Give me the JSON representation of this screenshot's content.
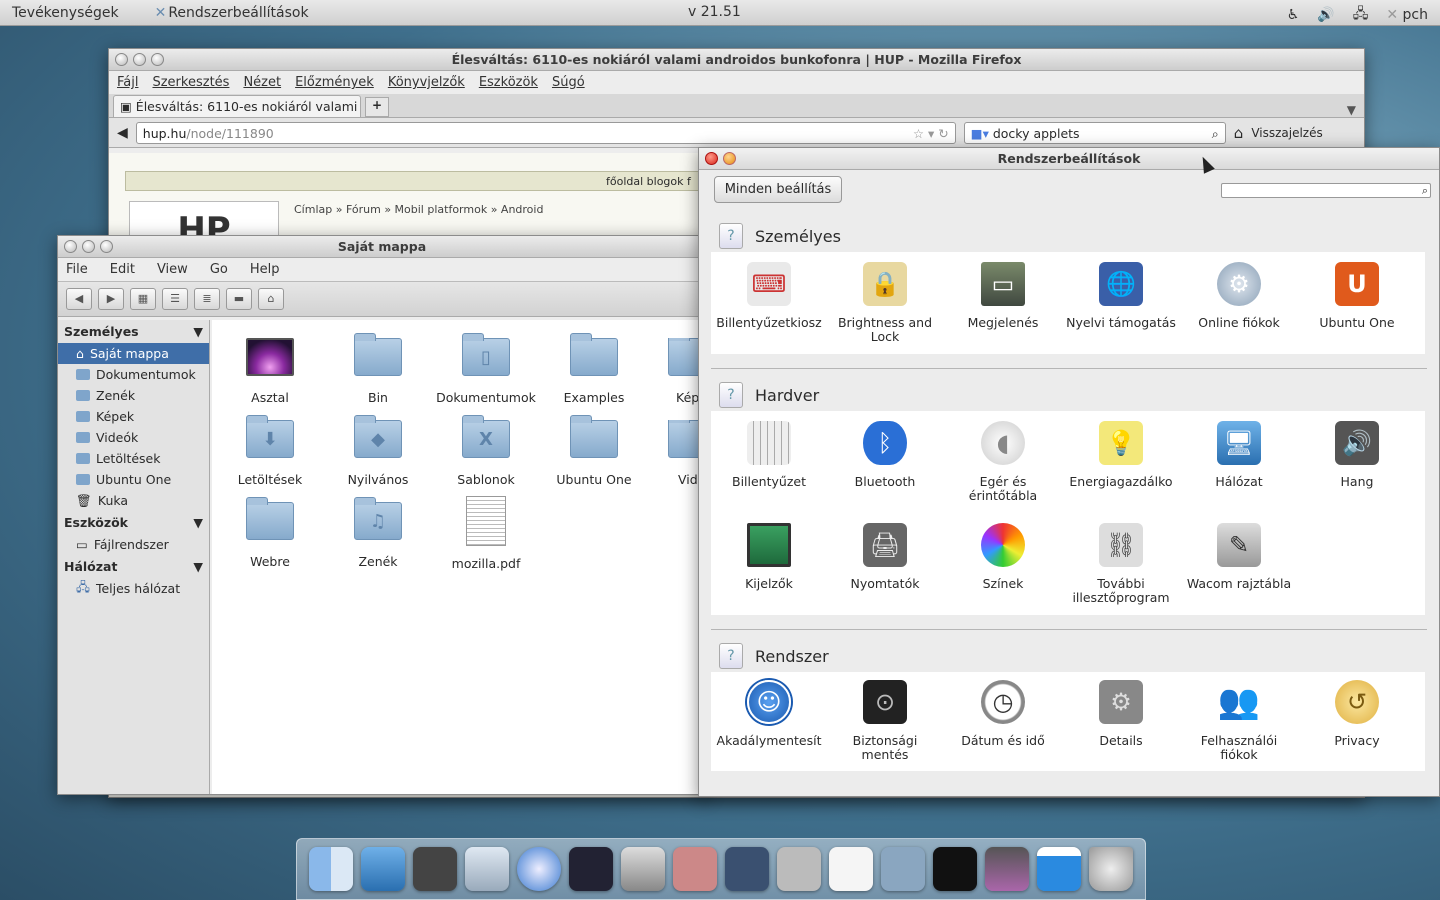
{
  "topbar": {
    "activities": "Tevékenységek",
    "app_name": "Rendszerbeállítások",
    "clock": "v 21.51",
    "user": "pch"
  },
  "firefox": {
    "title": "Élesváltás: 6110-es nokiáról valami androidos bunkofonra | HUP - Mozilla Firefox",
    "menu": [
      "Fájl",
      "Szerkesztés",
      "Nézet",
      "Előzmények",
      "Könyvjelzők",
      "Eszközök",
      "Súgó"
    ],
    "tab_label": "Élesváltás: 6110-es nokiáról valami ...",
    "url_domain": "hup.hu",
    "url_path": "/node/111890",
    "search_value": "docky applets",
    "bookmark_label": "Visszajelzés",
    "site_nav": "főoldal  blogok  f",
    "logo_text": "HP",
    "breadcrumb": "Címlap » Fórum » Mobil platformok » Android"
  },
  "nautilus": {
    "title": "Saját mappa",
    "menu": [
      "File",
      "Edit",
      "View",
      "Go",
      "Help"
    ],
    "sidebar": {
      "personal_header": "Személyes",
      "personal": [
        "Saját mappa",
        "Dokumentumok",
        "Zenék",
        "Képek",
        "Videók",
        "Letöltések",
        "Ubuntu One",
        "Kuka"
      ],
      "tools_header": "Eszközök",
      "tools": [
        "Fájlrendszer"
      ],
      "network_header": "Hálózat",
      "network": [
        "Teljes hálózat"
      ]
    },
    "files": [
      "Asztal",
      "Bin",
      "Dokumentumok",
      "Examples",
      "Kép",
      "Letöltések",
      "Nyilvános",
      "Sablonok",
      "Ubuntu One",
      "Vid",
      "Webre",
      "Zenék",
      "mozilla.pdf"
    ]
  },
  "settings": {
    "title": "Rendszerbeállítások",
    "all_button": "Minden beállítás",
    "sections": {
      "personal": {
        "title": "Személyes",
        "items": [
          "Billentyűzetkiosz",
          "Brightness and Lock",
          "Megjelenés",
          "Nyelvi támogatás",
          "Online fiókok",
          "Ubuntu One"
        ]
      },
      "hardware": {
        "title": "Hardver",
        "items": [
          "Billentyűzet",
          "Bluetooth",
          "Egér és érintőtábla",
          "Energiagazdálko",
          "Hálózat",
          "Hang",
          "Kijelzők",
          "Nyomtatók",
          "Színek",
          "További illesztőprogram",
          "Wacom rajztábla"
        ]
      },
      "system": {
        "title": "Rendszer",
        "items": [
          "Akadálymentesít",
          "Biztonsági mentés",
          "Dátum és idő",
          "Details",
          "Felhasználói fiókok",
          "Privacy"
        ]
      }
    }
  },
  "icons": {
    "question": "?",
    "ubuntu_one": "U",
    "bluetooth": "ᛒ",
    "accessibility": "☺",
    "close": "×"
  }
}
